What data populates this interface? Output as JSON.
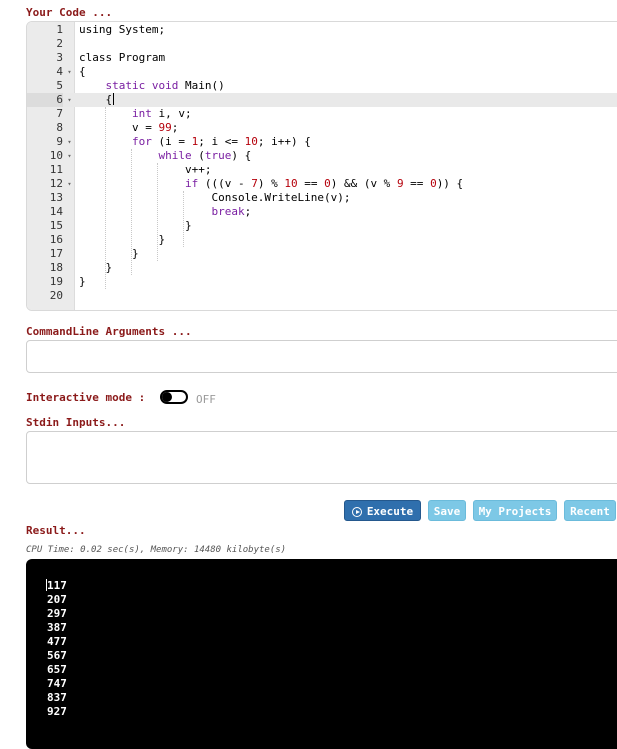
{
  "labels": {
    "your_code": "Your Code ...",
    "command_line": "CommandLine Arguments ...",
    "interactive_mode": "Interactive mode :",
    "interactive_state": "OFF",
    "stdin": "Stdin Inputs...",
    "result": "Result..."
  },
  "editor": {
    "active_line": 6,
    "lines": [
      {
        "n": "1",
        "fold": false,
        "html": "<span>using System;</span>"
      },
      {
        "n": "2",
        "fold": false,
        "html": ""
      },
      {
        "n": "3",
        "fold": false,
        "html": "<span>class Program</span>"
      },
      {
        "n": "4",
        "fold": true,
        "html": "<span>{</span>"
      },
      {
        "n": "5",
        "fold": false,
        "html": "    <span class=\"kw\">static void</span> Main()"
      },
      {
        "n": "6",
        "fold": true,
        "html": "    {<span class=\"cursor\"></span>"
      },
      {
        "n": "7",
        "fold": false,
        "html": "        <span class=\"kw\">int</span> i, v;"
      },
      {
        "n": "8",
        "fold": false,
        "html": "        v = <span class=\"num\">99</span>;"
      },
      {
        "n": "9",
        "fold": true,
        "html": "        <span class=\"kw\">for</span> (i = <span class=\"num\">1</span>; i &lt;= <span class=\"num\">10</span>; i++) {"
      },
      {
        "n": "10",
        "fold": true,
        "html": "            <span class=\"kw\">while</span> (<span class=\"kw\">true</span>) {"
      },
      {
        "n": "11",
        "fold": false,
        "html": "                v++;"
      },
      {
        "n": "12",
        "fold": true,
        "html": "                <span class=\"kw\">if</span> (((v - <span class=\"num\">7</span>) % <span class=\"num\">10</span> == <span class=\"num\">0</span>) &amp;&amp; (v % <span class=\"num\">9</span> == <span class=\"num\">0</span>)) {"
      },
      {
        "n": "13",
        "fold": false,
        "html": "                    Console.WriteLine(v);"
      },
      {
        "n": "14",
        "fold": false,
        "html": "                    <span class=\"kw\">break</span>;"
      },
      {
        "n": "15",
        "fold": false,
        "html": "                }"
      },
      {
        "n": "16",
        "fold": false,
        "html": "            }"
      },
      {
        "n": "17",
        "fold": false,
        "html": "        }"
      },
      {
        "n": "18",
        "fold": false,
        "html": "    }"
      },
      {
        "n": "19",
        "fold": false,
        "html": "}"
      },
      {
        "n": "20",
        "fold": false,
        "html": ""
      }
    ]
  },
  "command_line_input": {
    "value": ""
  },
  "stdin_input": {
    "value": ""
  },
  "buttons": {
    "execute": "Execute",
    "save": "Save",
    "my_projects": "My Projects",
    "recent": "Recent"
  },
  "result": {
    "cpu_info": "CPU Time: 0.02 sec(s), Memory: 14480 kilobyte(s)",
    "output_lines": [
      "117",
      "207",
      "297",
      "387",
      "477",
      "567",
      "657",
      "747",
      "837",
      "927"
    ]
  },
  "colors": {
    "label": "#8b1a1a",
    "execute_button": "#2f6fad",
    "secondary_button": "#7dc8e6",
    "output_background": "#000000"
  }
}
